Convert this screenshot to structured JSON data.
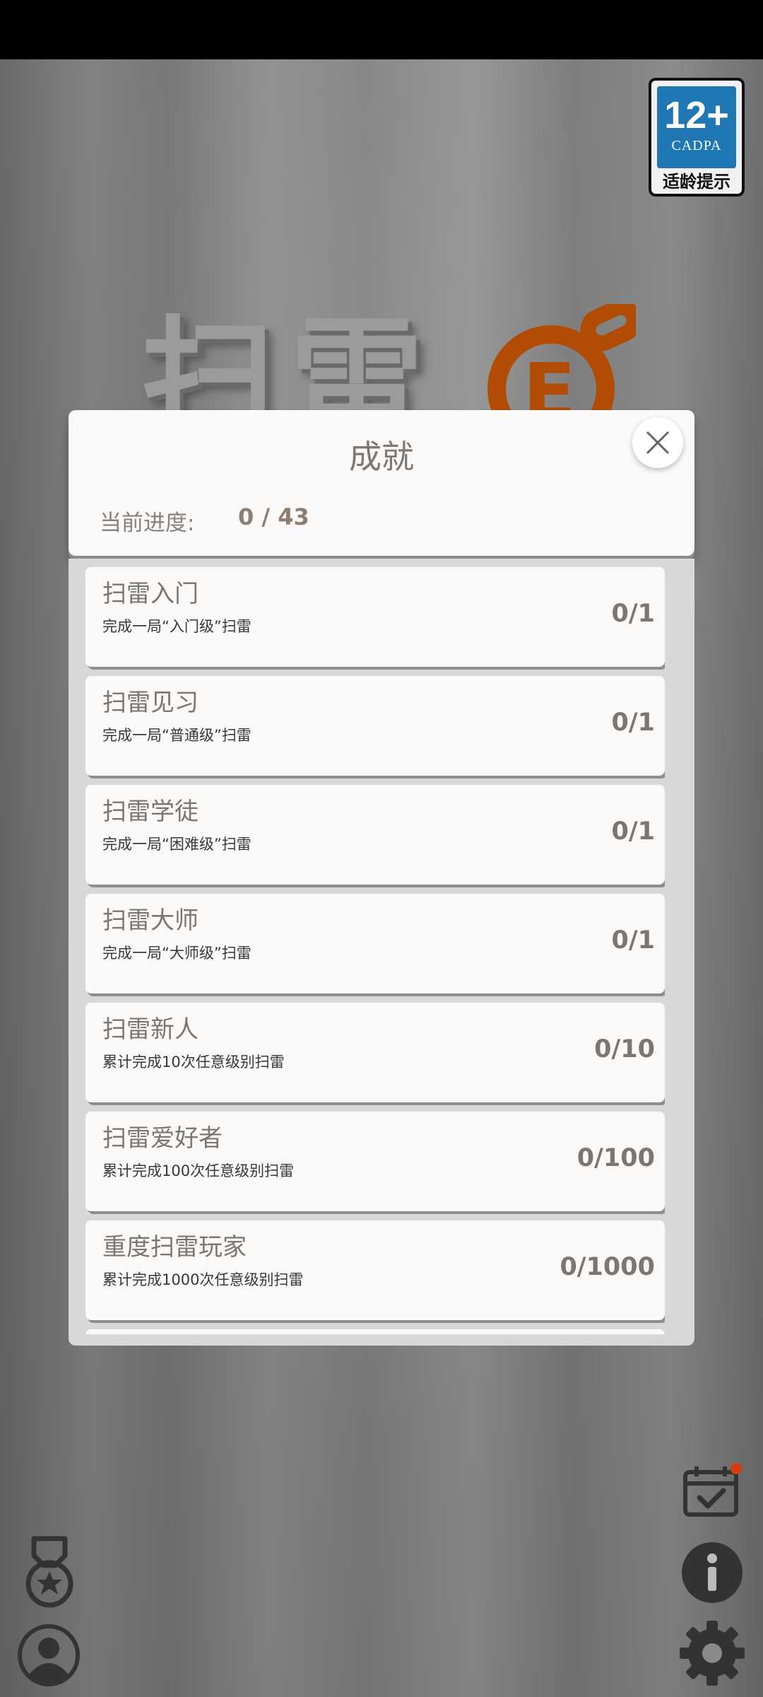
{
  "age_rating": {
    "number": "12+",
    "org": "CADPA",
    "tip": "适龄提示"
  },
  "game_title": {
    "chars": "扫雷",
    "logo_letter": "E",
    "accent_color": "#b24c05"
  },
  "modal": {
    "title": "成就",
    "progress_label": "当前进度:",
    "progress_value": "0 / 43",
    "progress": {
      "done": 0,
      "total": 43
    },
    "close_icon": "close-icon"
  },
  "achievements": [
    {
      "name": "扫雷入门",
      "desc": "完成一局“入门级”扫雷",
      "count": "0/1"
    },
    {
      "name": "扫雷见习",
      "desc": "完成一局“普通级”扫雷",
      "count": "0/1"
    },
    {
      "name": "扫雷学徒",
      "desc": "完成一局“困难级”扫雷",
      "count": "0/1"
    },
    {
      "name": "扫雷大师",
      "desc": "完成一局“大师级”扫雷",
      "count": "0/1"
    },
    {
      "name": "扫雷新人",
      "desc": "累计完成10次任意级别扫雷",
      "count": "0/10"
    },
    {
      "name": "扫雷爱好者",
      "desc": "累计完成100次任意级别扫雷",
      "count": "0/100"
    },
    {
      "name": "重度扫雷玩家",
      "desc": "累计完成1000次任意级别扫雷",
      "count": "0/1000"
    }
  ],
  "bottom_icons": {
    "left": [
      "medal-icon",
      "user-icon"
    ],
    "right": [
      "calendar-check-icon",
      "info-icon",
      "gear-icon"
    ],
    "notification_color": "#d43d0e"
  }
}
